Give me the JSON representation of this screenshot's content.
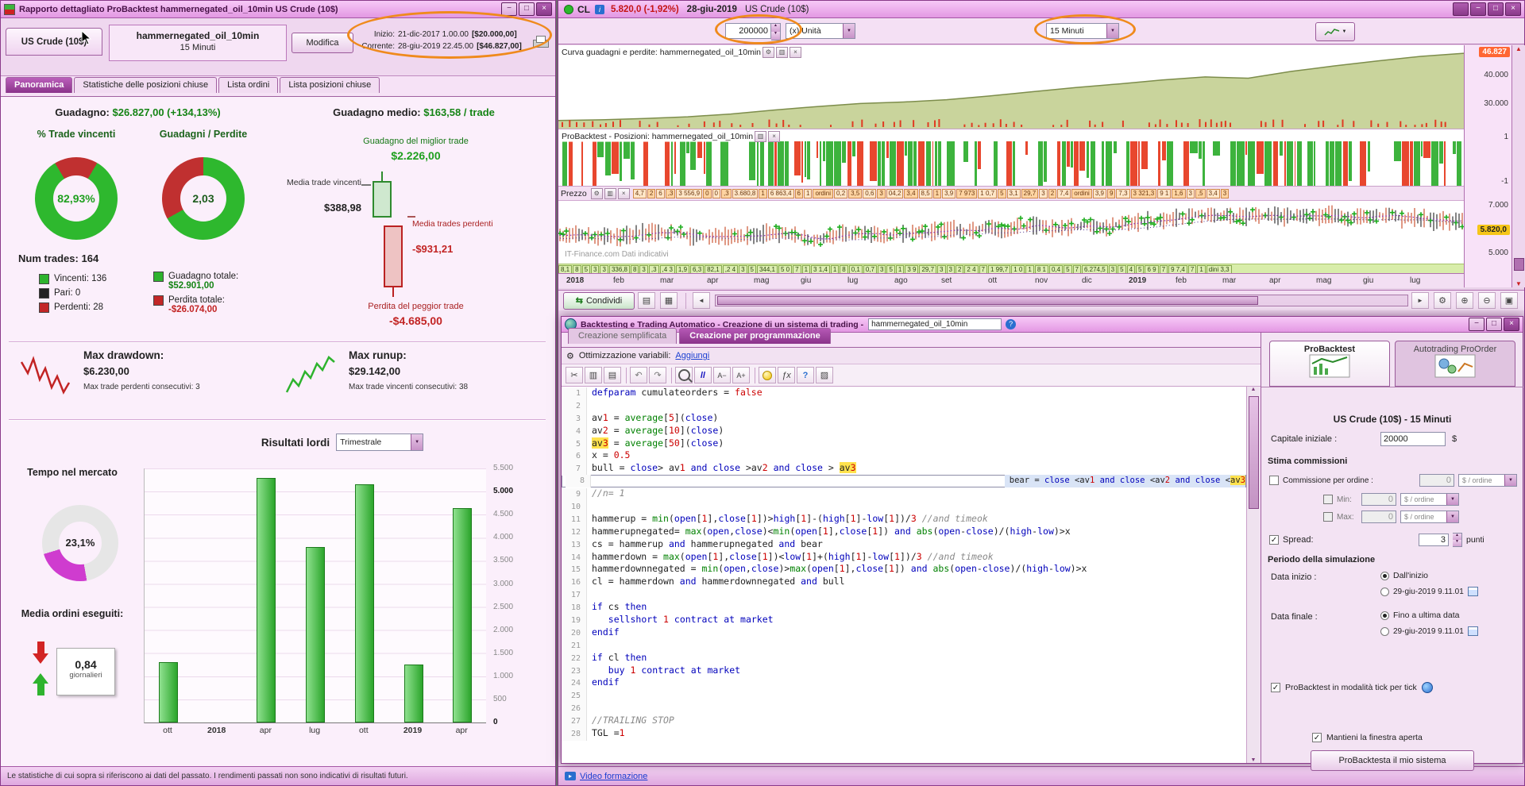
{
  "icons": {
    "minimize": "−",
    "maximize": "□",
    "close": "×",
    "info": "i",
    "help": "?",
    "dropdown": "▼",
    "up": "▲",
    "down": "▼",
    "check": "✓",
    "scroll_left": "◄",
    "scroll_right": "►",
    "cut": "✂",
    "copy": "▥",
    "paste": "▤",
    "undo": "↶",
    "redo": "↷",
    "comment": "//",
    "font_small": "A−",
    "font_big": "A+",
    "fx": "ƒx",
    "zoom_in": "⊕",
    "zoom_out": "⊖",
    "expand": "▣",
    "list": "▤",
    "calendar": "▦",
    "print": "▨",
    "wrench": "⚙",
    "share": "⇆",
    "play": "▸"
  },
  "report_window": {
    "title": "Rapporto dettagliato   ProBacktest   hammernegated_oil_10min   US Crude (10$)",
    "instrument_tab": "US Crude (10$)",
    "system_name": "hammernegated_oil_10min",
    "system_timeframe": "15 Minuti",
    "modify_button": "Modifica",
    "start_label": "Inizio:",
    "start_value": "21-dic-2017 1.00.00",
    "start_capital": "[$20.000,00]",
    "current_label": "Corrente:",
    "current_value": "28-giu-2019 22.45.00",
    "current_capital": "[$46.827,00]",
    "tabs": [
      {
        "label": "Panoramica",
        "active": true
      },
      {
        "label": "Statistiche delle posizioni chiuse",
        "active": false
      },
      {
        "label": "Lista ordini",
        "active": false
      },
      {
        "label": "Lista posizioni chiuse",
        "active": false
      }
    ],
    "gain_label": "Guadagno:",
    "gain_value": "$26.827,00 (+134,13%)",
    "avg_gain_label": "Guadagno medio:",
    "avg_gain_value": "$163,58 / trade",
    "winrate_title": "% Trade vincenti",
    "winrate_value": "82,93%",
    "pf_title": "Guadagni / Perdite",
    "pf_value": "2,03",
    "num_trades_label": "Num trades:",
    "num_trades_value": "164",
    "legend": [
      {
        "label": "Vincenti: 136",
        "color": "#2eb32e"
      },
      {
        "label": "Pari: 0",
        "color": "#222222"
      },
      {
        "label": "Perdenti: 28",
        "color": "#c22727"
      }
    ],
    "totals": [
      {
        "label": "Guadagno totale:",
        "value": "$52.901,00",
        "color": "#2eb32e",
        "cls": "grn"
      },
      {
        "label": "Perdita totale:",
        "value": "-$26.074,00",
        "color": "#c22727",
        "cls": "red"
      }
    ],
    "best_trade_label": "Guadagno del miglior trade",
    "best_trade_value": "$2.226,00",
    "avg_win_label": "Media trade vincenti",
    "avg_win_value": "$388,98",
    "avg_loss_label": "Media trades perdenti",
    "avg_loss_value": "-$931,21",
    "worst_trade_label": "Perdita del peggior trade",
    "worst_trade_value": "-$4.685,00",
    "max_drawdown_label": "Max drawdown:",
    "max_drawdown_value": "$6.230,00",
    "max_drawdown_sub": "Max trade perdenti consecutivi: 3",
    "max_runup_label": "Max runup:",
    "max_runup_value": "$29.142,00",
    "max_runup_sub": "Max trade vincenti consecutivi: 38",
    "gross_label": "Risultati lordi",
    "gross_select": "Trimestrale",
    "time_in_market_title": "Tempo nel mercato",
    "time_in_market_value": "23,1%",
    "avg_orders_label": "Media ordini eseguiti:",
    "avg_orders_value": "0,84",
    "avg_orders_unit": "giornalieri",
    "disclaimer": "Le statistiche di cui sopra si riferiscono ai dati del passato. I rendimenti passati non sono indicativi di risultati futuri."
  },
  "chart_window": {
    "symbol": "CL",
    "price": "5.820,0 (-1,92%)",
    "date": "28-giu-2019",
    "instrument": "US Crude (10$)",
    "qty_value": "200000",
    "unit_select": "(x) Unità",
    "timeframe_select": "15 Minuti",
    "equity_title": "Curva guadagni e perdite: hammernegated_oil_10min",
    "equity_axis": [
      "46.827",
      "40.000",
      "30.000"
    ],
    "positions_title": "ProBacktest - Posizioni: hammernegated_oil_10min",
    "positions_axis_top": "1",
    "positions_axis_bottom": "-1",
    "price_title": "Prezzo",
    "price_axis_top": "7.000",
    "price_axis_badge": "5.820,0",
    "price_axis_bottom": "5.000",
    "watermark": "IT-Finance.com  Dati indicativi",
    "x_axis": [
      "2018",
      "feb",
      "mar",
      "apr",
      "mag",
      "giu",
      "lug",
      "ago",
      "set",
      "ott",
      "nov",
      "dic",
      "2019",
      "feb",
      "mar",
      "apr",
      "mag",
      "giu",
      "lug"
    ],
    "price_strip": [
      "4,7",
      "2",
      "6",
      ",3",
      "3 556,9",
      "0",
      "0",
      ",3",
      "3.680,8",
      "1",
      "6 863,4",
      "6",
      "1",
      "ordini",
      "0,2",
      "3,5",
      "0,6",
      "3",
      "04,2",
      "3,4",
      "8,5",
      "1",
      "3,9",
      "7 973",
      "1 0,7",
      "5",
      "3,1",
      "29,7",
      "3",
      "2",
      "7,4",
      "ordini",
      "3,9",
      "9",
      "7,3",
      "3 321,3",
      "9 1",
      "1,6",
      "3",
      ",5",
      "3,4",
      "3"
    ],
    "volume_strip": [
      "8,1",
      "8",
      "5",
      "3",
      "3",
      "336,8",
      "8",
      "3",
      ",3",
      ",4 3",
      "1,9",
      "6,3",
      "82,1",
      ",2 4",
      "3",
      "5",
      "344,1",
      "5 0",
      "7",
      "1",
      "3 1,4",
      "1",
      "8",
      "0,1",
      "0,7",
      "3",
      "5",
      "1",
      "3 9",
      "29,7",
      "3",
      "3",
      "2",
      "2 4",
      "7",
      "1 99,7",
      "1 0",
      "1",
      "8 1",
      "0,4",
      "5",
      "7",
      "6.274,5",
      "3",
      "5",
      "4",
      "5",
      "6 9",
      "7",
      "9 7,4",
      "7",
      "1",
      "dini 3,3"
    ],
    "share_button": "Condividi"
  },
  "backtest_window": {
    "title": "Backtesting e Trading Automatico - Creazione di un sistema di trading -",
    "system_name_value": "hammernegated_oil_10min",
    "tabs": [
      {
        "label": "Creazione semplificata",
        "active": false
      },
      {
        "label": "Creazione per programmazione",
        "active": true
      }
    ],
    "optimization_label": "Ottimizzazione variabili:",
    "add_link": "Aggiungi",
    "highlight_term": "av3",
    "selected_line": 8,
    "code_lines": [
      "defparam cumulateorders = false",
      "",
      "av1 = average[5](close)",
      "av2 = average[10](close)",
      "av3 = average[50](close)",
      "x = 0.5",
      "bull = close> av1 and close >av2 and close > av3",
      "bear = close <av1 and close <av2 and close <av3",
      "//n= 1",
      "",
      "hammerup = min(open[1],close[1])>high[1]-(high[1]-low[1])/3 //and timeok",
      "hammerupnegated= max(open,close)<min(open[1],close[1]) and abs(open-close)/(high-low)>x",
      "cs = hammerup and hammerupnegated and bear",
      "hammerdown = max(open[1],close[1])<low[1]+(high[1]-low[1])/3 //and timeok",
      "hammerdownnegated = min(open,close)>max(open[1],close[1]) and abs(open-close)/(high-low)>x",
      "cl = hammerdown and hammerdownnegated and bull",
      "",
      "if cs then",
      "   sellshort 1 contract at market",
      "endif",
      "",
      "if cl then",
      "   buy 1 contract at market",
      "endif",
      "",
      "",
      "//TRAILING STOP",
      "TGL =1"
    ]
  },
  "config_panel": {
    "tabs": [
      {
        "label": "ProBacktest",
        "active": true
      },
      {
        "label": "Autotrading ProOrder",
        "active": false
      }
    ],
    "instrument_line": "US Crude (10$) - 15 Minuti",
    "capital_label": "Capitale iniziale :",
    "capital_value": "20000",
    "capital_unit": "$",
    "commissions_title": "Stima commissioni",
    "commission_label": "Commissione per ordine :",
    "commission_value": "0",
    "commission_unit": "$ / ordine",
    "min_label": "Min:",
    "min_value": "0",
    "min_unit": "$ / ordine",
    "max_label": "Max:",
    "max_value": "0",
    "max_unit": "$ / ordine",
    "spread_label": "Spread:",
    "spread_value": "3",
    "spread_unit": "punti",
    "period_title": "Periodo della simulazione",
    "start_label": "Data inizio :",
    "start_option1": "Dall'inizio",
    "start_option2": "29-giu-2019 9.11.01",
    "end_label": "Data finale :",
    "end_option1": "Fino a ultima data",
    "end_option2": "29-giu-2019 9.11.01",
    "tick_checkbox": "ProBacktest in modalità tick per tick",
    "keep_open_checkbox": "Mantieni la finestra aperta",
    "run_button": "ProBacktesta il mio sistema"
  },
  "status_right": {
    "link": "Video formazione"
  },
  "chart_data": [
    {
      "type": "donut",
      "name": "win-rate",
      "title": "% Trade vincenti",
      "center_label": "82,93%",
      "slices": [
        {
          "label": "perdenti",
          "value": 17.07,
          "color": "#c03030"
        },
        {
          "label": "vincenti",
          "value": 82.93,
          "color": "#2eb82e"
        }
      ]
    },
    {
      "type": "donut",
      "name": "profit-factor",
      "title": "Guadagni / Perdite",
      "center_label": "2,03",
      "slices": [
        {
          "label": "perdite",
          "value": 33,
          "color": "#c03030"
        },
        {
          "label": "guadagni",
          "value": 67,
          "color": "#2eb82e"
        }
      ]
    },
    {
      "type": "bar",
      "name": "gross-results-quarterly",
      "title": "Risultati lordi (Trimestrale)",
      "categories": [
        "ott",
        "2018",
        "apr",
        "lug",
        "ott",
        "2019",
        "apr"
      ],
      "values": [
        1300,
        0,
        5300,
        3800,
        5150,
        1250,
        4650
      ],
      "ylim": [
        0,
        5500
      ],
      "ytick_step": 500,
      "bar_color": "#3cc43c",
      "bold_ticks": [
        0,
        5000
      ]
    },
    {
      "type": "donut",
      "name": "time-in-market",
      "title": "Tempo nel mercato",
      "center_label": "23,1%",
      "slices": [
        {
          "label": "nel mercato",
          "value": 23.1,
          "color": "#cf3ccf"
        },
        {
          "label": "fuori mercato",
          "value": 76.9,
          "color": "#e6e6e6"
        }
      ]
    },
    {
      "type": "area",
      "name": "equity-curve",
      "title": "Curva guadagni e perdite: hammernegated_oil_10min",
      "x_labels": [
        "2018",
        "feb",
        "mar",
        "apr",
        "mag",
        "giu",
        "lug",
        "ago",
        "set",
        "ott",
        "nov",
        "dic",
        "2019",
        "feb",
        "mar",
        "apr",
        "mag",
        "giu",
        "lug"
      ],
      "points": [
        20000,
        20300,
        20800,
        21500,
        22600,
        24200,
        25600,
        26800,
        27400,
        28300,
        29800,
        31500,
        33200,
        34600,
        36200,
        37400,
        36900,
        39600,
        41800,
        43800,
        45600,
        46827
      ],
      "ylim": [
        19000,
        47500
      ],
      "yticks": [
        30000,
        40000
      ],
      "final_value": 46827
    }
  ]
}
